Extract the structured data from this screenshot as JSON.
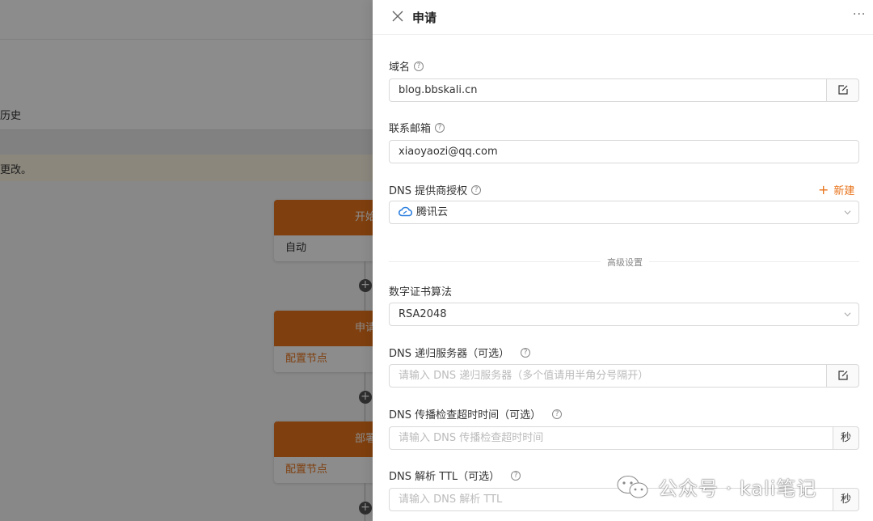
{
  "background": {
    "tab_partial": "历史",
    "notice_partial": "更改。",
    "nodes": [
      {
        "head": "开始",
        "body": "自动",
        "body_link": false
      },
      {
        "head": "申请",
        "body": "配置节点",
        "body_link": true
      },
      {
        "head": "部署",
        "body": "配置节点",
        "body_link": true
      }
    ]
  },
  "drawer": {
    "title": "申请",
    "more_label": "···",
    "fields": {
      "domain": {
        "label": "域名",
        "value": "blog.bbskali.cn"
      },
      "email": {
        "label": "联系邮箱",
        "value": "xiaoyaozi@qq.com"
      },
      "dns_provider": {
        "label": "DNS 提供商授权",
        "value": "腾讯云",
        "new_label": "新建"
      },
      "advanced_divider": "高级设置",
      "algorithm": {
        "label": "数字证书算法",
        "value": "RSA2048"
      },
      "dns_server": {
        "label": "DNS 递归服务器（可选）",
        "placeholder": "请输入 DNS 递归服务器（多个值请用半角分号隔开）"
      },
      "dns_timeout": {
        "label": "DNS 传播检查超时时间（可选）",
        "placeholder": "请输入 DNS 传播检查超时时间",
        "unit": "秒"
      },
      "dns_ttl": {
        "label": "DNS 解析 TTL（可选）",
        "placeholder": "请输入 DNS 解析 TTL",
        "unit": "秒"
      }
    }
  },
  "watermark": {
    "text": "公众号 · kali笔记"
  },
  "colors": {
    "accent": "#e8731a",
    "cloud_blue": "#2b7fe0"
  }
}
